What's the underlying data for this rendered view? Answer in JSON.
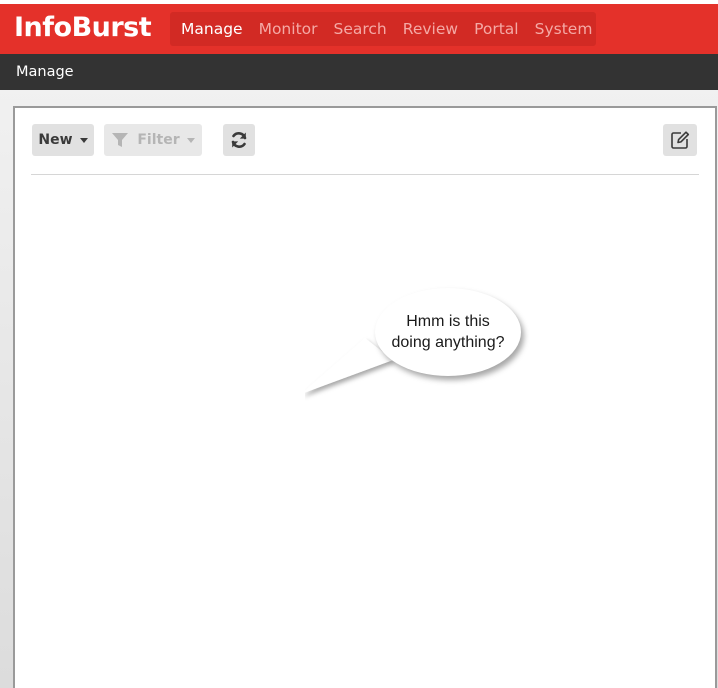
{
  "app": {
    "brand": "InfoBurst"
  },
  "nav": {
    "items": [
      {
        "label": "Manage",
        "active": true
      },
      {
        "label": "Monitor"
      },
      {
        "label": "Search"
      },
      {
        "label": "Review"
      },
      {
        "label": "Portal"
      },
      {
        "label": "System"
      }
    ]
  },
  "breadcrumb": {
    "label": "Manage"
  },
  "toolbar": {
    "new_label": "New",
    "filter_label": "Filter",
    "refresh_icon": "refresh-icon",
    "edit_icon": "edit-icon"
  },
  "annotation": {
    "text": "Hmm is this doing anything?"
  },
  "colors": {
    "brand_red": "#e4312a",
    "nav_bg": "#d22a24",
    "subbar_bg": "#333333"
  }
}
